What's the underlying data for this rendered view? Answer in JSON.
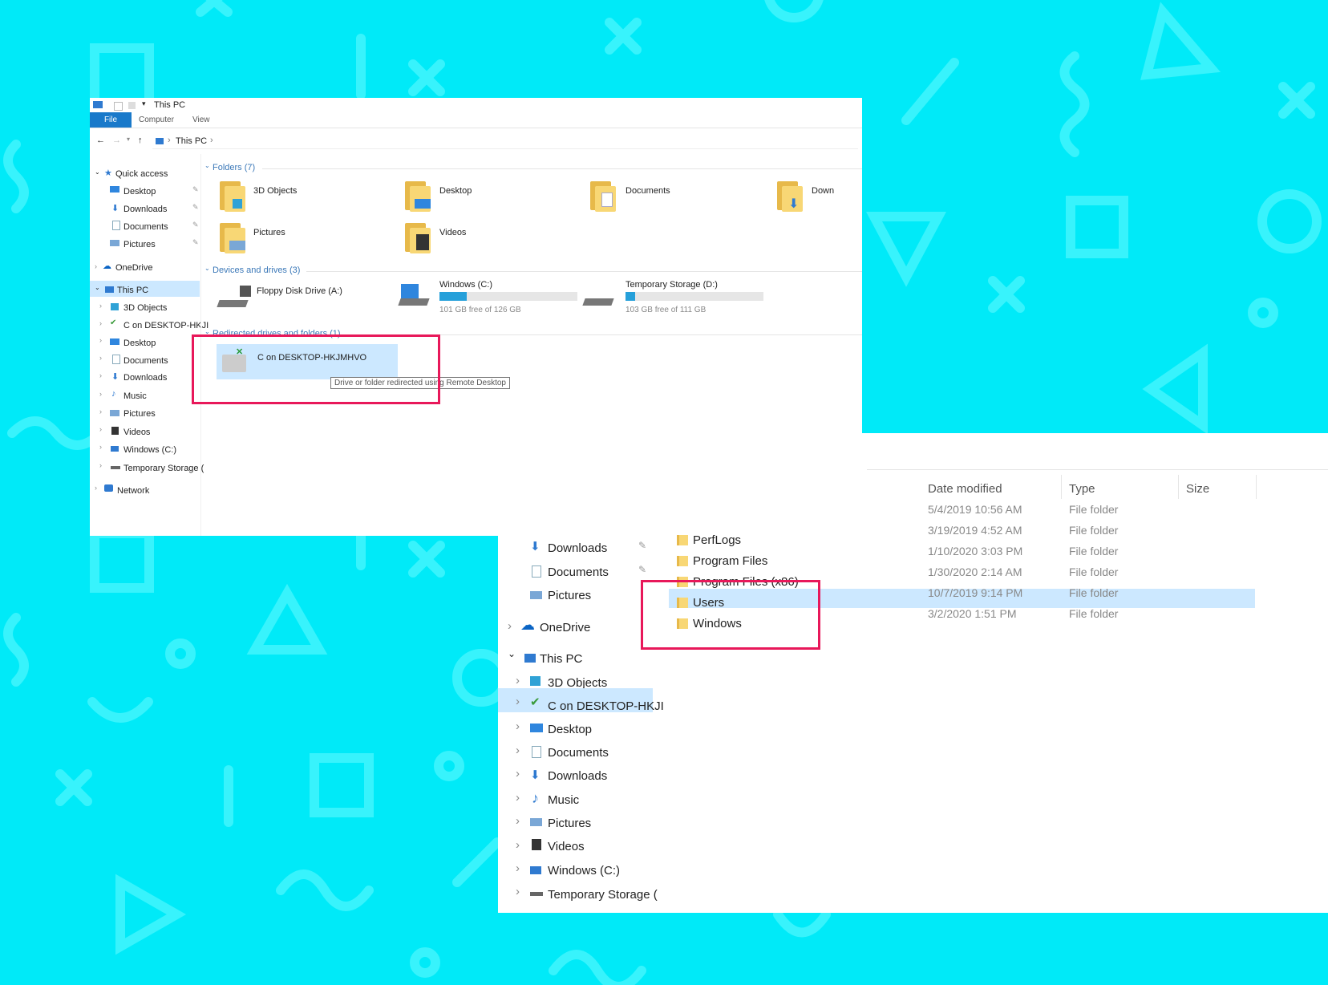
{
  "window_top": {
    "title": "This PC",
    "ribbon_tabs": [
      "File",
      "Computer",
      "View"
    ],
    "breadcrumb": [
      "This PC"
    ],
    "nav": {
      "quick_access": "Quick access",
      "qa_items": [
        "Desktop",
        "Downloads",
        "Documents",
        "Pictures"
      ],
      "onedrive": "OneDrive",
      "this_pc": "This PC",
      "pc_items": [
        "3D Objects",
        "C on DESKTOP-HKJI",
        "Desktop",
        "Documents",
        "Downloads",
        "Music",
        "Pictures",
        "Videos",
        "Windows (C:)",
        "Temporary Storage ("
      ],
      "network": "Network"
    },
    "folders_header": "Folders (7)",
    "folders": [
      "3D Objects",
      "Desktop",
      "Documents",
      "Down",
      "Pictures",
      "Videos"
    ],
    "devices_header": "Devices and drives (3)",
    "drives": [
      {
        "name": "Floppy Disk Drive (A:)",
        "free": "",
        "usage": null
      },
      {
        "name": "Windows (C:)",
        "free": "101 GB free of 126 GB",
        "usage": 0.2
      },
      {
        "name": "Temporary Storage (D:)",
        "free": "103 GB free of 111 GB",
        "usage": 0.07
      }
    ],
    "redirected_header": "Redirected drives and folders (1)",
    "redirected_item": "C on DESKTOP-HKJMHVO",
    "tooltip": "Drive or folder redirected using Remote Desktop"
  },
  "window_bottom": {
    "columns": [
      "Date modified",
      "Type",
      "Size"
    ],
    "nav_quick": [
      {
        "label": "Downloads",
        "pinned": true
      },
      {
        "label": "Documents",
        "pinned": true
      },
      {
        "label": "Pictures",
        "pinned": false
      }
    ],
    "onedrive": "OneDrive",
    "this_pc": "This PC",
    "pc_items": [
      "3D Objects",
      "C on DESKTOP-HKJI",
      "Desktop",
      "Documents",
      "Downloads",
      "Music",
      "Pictures",
      "Videos",
      "Windows (C:)",
      "Temporary Storage ("
    ],
    "rows": [
      {
        "name": "",
        "date": "5/4/2019 10:56 AM",
        "type": "File folder"
      },
      {
        "name": "PerfLogs",
        "date": "3/19/2019 4:52 AM",
        "type": "File folder"
      },
      {
        "name": "Program Files",
        "date": "1/10/2020 3:03 PM",
        "type": "File folder"
      },
      {
        "name": "Program Files (x86)",
        "date": "1/30/2020 2:14 AM",
        "type": "File folder"
      },
      {
        "name": "Users",
        "date": "10/7/2019 9:14 PM",
        "type": "File folder"
      },
      {
        "name": "Windows",
        "date": "3/2/2020 1:51 PM",
        "type": "File folder"
      }
    ]
  },
  "colors": {
    "background": "#00eaf8",
    "highlight": "#e8185a",
    "selection": "#cce8ff",
    "accent": "#0063b1"
  }
}
